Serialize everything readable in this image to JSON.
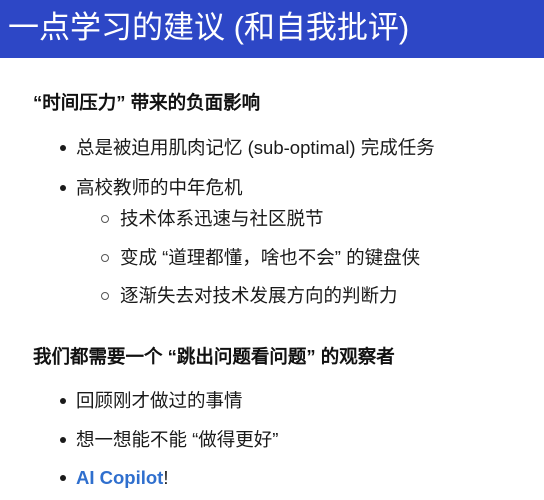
{
  "title": "一点学习的建议 (和自我批评)",
  "accent_color": "#2d47c6",
  "link_color": "#2f6fce",
  "section1": {
    "heading": "“时间压力” 带来的负面影响",
    "items": [
      {
        "text": "总是被迫用肌肉记忆 (sub-optimal) 完成任务"
      },
      {
        "text": "高校教师的中年危机",
        "subitems": [
          "技术体系迅速与社区脱节",
          "变成 “道理都懂，啥也不会” 的键盘侠",
          "逐渐失去对技术发展方向的判断力"
        ]
      }
    ]
  },
  "section2": {
    "heading": "我们都需要一个 “跳出问题看问题” 的观察者",
    "items": [
      "回顾刚才做过的事情",
      "想一想能不能 “做得更好”"
    ],
    "link_item": {
      "link_text": "AI Copilot",
      "suffix": "!"
    }
  }
}
